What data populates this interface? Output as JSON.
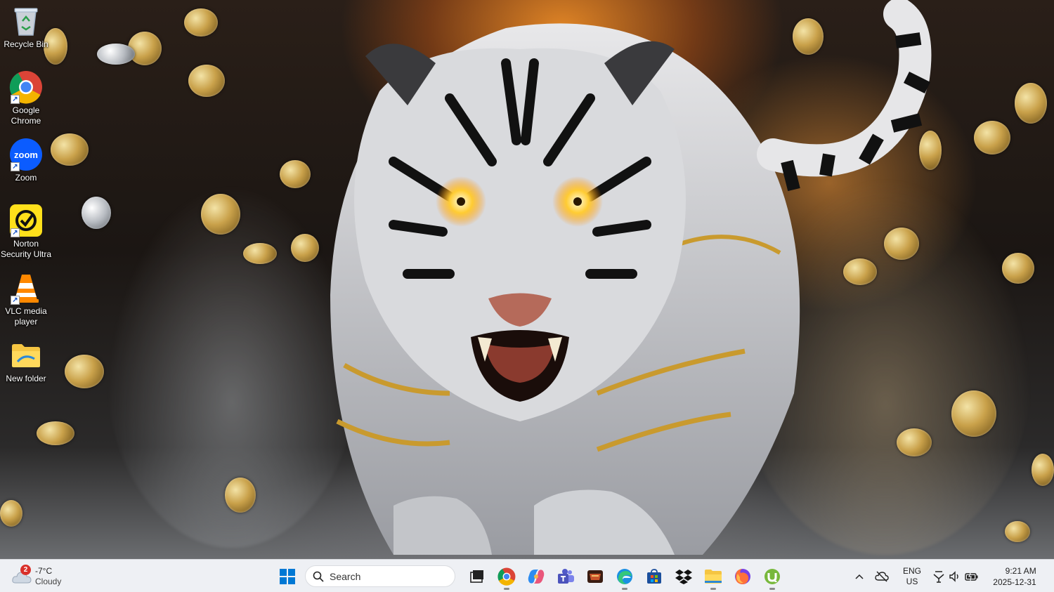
{
  "desktop": {
    "icons": [
      {
        "label": "Recycle Bin",
        "icon": "recycle-bin-icon",
        "shortcut": false
      },
      {
        "label": "Google Chrome",
        "icon": "chrome-icon",
        "shortcut": true
      },
      {
        "label": "Zoom",
        "icon": "zoom-icon",
        "shortcut": true
      },
      {
        "label": "Norton Security Ultra",
        "icon": "norton-icon",
        "shortcut": true
      },
      {
        "label": "VLC media player",
        "icon": "vlc-icon",
        "shortcut": true
      },
      {
        "label": "New folder",
        "icon": "folder-icon",
        "shortcut": false
      }
    ],
    "zoom_text": "zoom"
  },
  "taskbar": {
    "weather": {
      "temp": "-7°C",
      "condition": "Cloudy",
      "badge": "2"
    },
    "search_placeholder": "Search",
    "pinned": [
      {
        "name": "start",
        "icon": "windows-start-icon",
        "running": false
      },
      {
        "name": "task-view",
        "icon": "task-view-icon",
        "running": false
      },
      {
        "name": "chrome",
        "icon": "chrome-icon",
        "running": true
      },
      {
        "name": "copilot",
        "icon": "copilot-icon",
        "running": false
      },
      {
        "name": "teams",
        "icon": "teams-icon",
        "running": false
      },
      {
        "name": "game",
        "icon": "game-icon",
        "running": false
      },
      {
        "name": "edge",
        "icon": "edge-icon",
        "running": true
      },
      {
        "name": "store",
        "icon": "store-icon",
        "running": false
      },
      {
        "name": "dropbox",
        "icon": "dropbox-icon",
        "running": false
      },
      {
        "name": "file-explorer",
        "icon": "file-explorer-icon",
        "running": true
      },
      {
        "name": "firefox",
        "icon": "firefox-icon",
        "running": false
      },
      {
        "name": "utorrent",
        "icon": "utorrent-icon",
        "running": true
      }
    ],
    "tray": {
      "language": "ENG",
      "region": "US",
      "time": "9:21 AM",
      "date": "2025-12-31"
    }
  },
  "colors": {
    "taskbar_bg": "#eef0f4",
    "windows_blue": "#0078d4",
    "badge_red": "#d9302a"
  }
}
